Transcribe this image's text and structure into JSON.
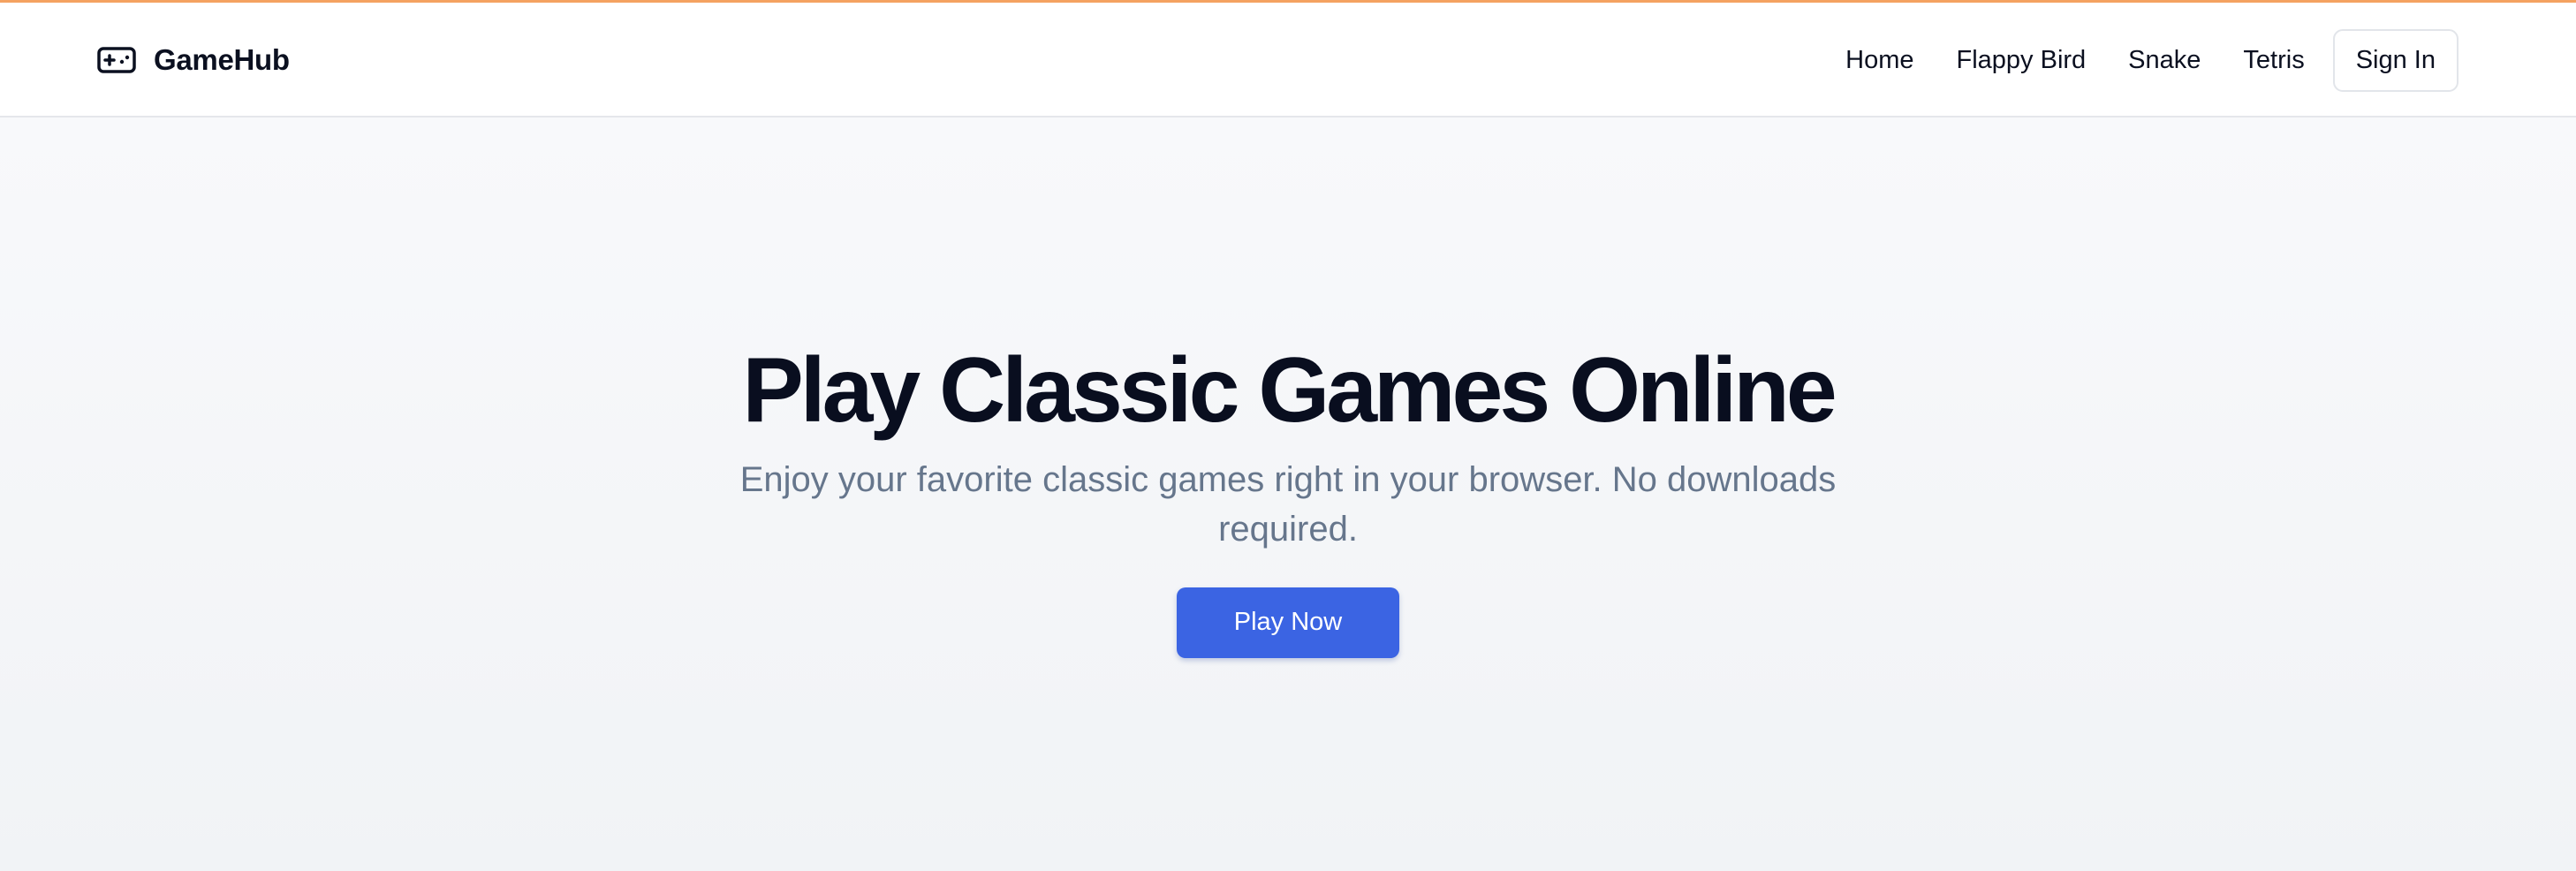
{
  "colors": {
    "accent_line": "#f4a261",
    "primary_button": "#3b64e3",
    "title_text": "#090e1f",
    "subtitle_text": "#66768c"
  },
  "header": {
    "brand": {
      "icon": "gamepad-icon",
      "label": "GameHub"
    },
    "nav": {
      "home": "Home",
      "flappy_bird": "Flappy Bird",
      "snake": "Snake",
      "tetris": "Tetris"
    },
    "sign_in": "Sign In"
  },
  "hero": {
    "title": "Play Classic Games Online",
    "subtitle": "Enjoy your favorite classic games right in your browser. No downloads required.",
    "cta": "Play Now"
  }
}
